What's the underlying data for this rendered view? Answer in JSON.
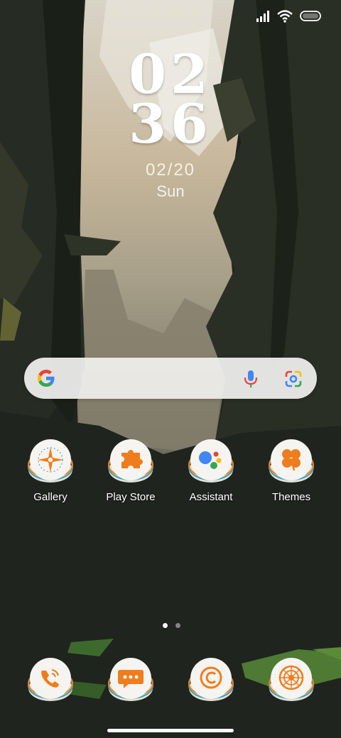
{
  "status_bar": {
    "signal": "signal-bars-icon",
    "wifi": "wifi-icon",
    "battery": "battery-icon"
  },
  "clock": {
    "hours": "02",
    "minutes": "36",
    "date": "02/20",
    "weekday": "Sun"
  },
  "search": {
    "google_icon": "google-g-icon",
    "mic_icon": "mic-icon",
    "lens_icon": "google-lens-icon"
  },
  "apps": [
    {
      "label": "Gallery",
      "icon": "flower-compass-icon"
    },
    {
      "label": "Play Store",
      "icon": "puzzle-icon"
    },
    {
      "label": "Assistant",
      "icon": "assistant-dots-icon"
    },
    {
      "label": "Themes",
      "icon": "clover-icon"
    }
  ],
  "dock": [
    {
      "name": "phone",
      "icon": "phone-icon"
    },
    {
      "name": "messages",
      "icon": "message-bubble-icon"
    },
    {
      "name": "browser",
      "icon": "c-logo-icon"
    },
    {
      "name": "camera",
      "icon": "camera-aperture-icon"
    }
  ],
  "pages": {
    "count": 2,
    "active": 1
  },
  "colors": {
    "accent_orange": "#ef7d1e",
    "accent_teal": "#3a9fb3",
    "icon_base": "#f4f2ee",
    "background": "#1f241e"
  }
}
